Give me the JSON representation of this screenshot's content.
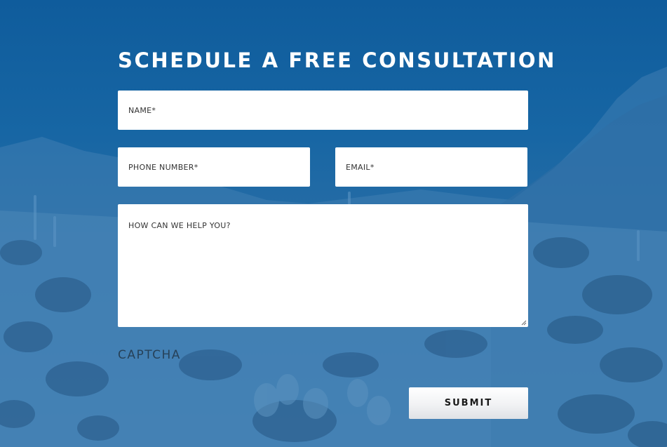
{
  "form": {
    "title": "SCHEDULE A FREE CONSULTATION",
    "name_placeholder": "NAME*",
    "phone_placeholder": "PHONE NUMBER*",
    "email_placeholder": "EMAIL*",
    "message_placeholder": "HOW CAN WE HELP YOU?",
    "captcha_label": "CAPTCHA",
    "submit_label": "SUBMIT"
  },
  "colors": {
    "background_tint": "#1766a4",
    "field_background": "#ffffff",
    "title_text": "#ffffff",
    "button_text": "#1a1a1a"
  }
}
